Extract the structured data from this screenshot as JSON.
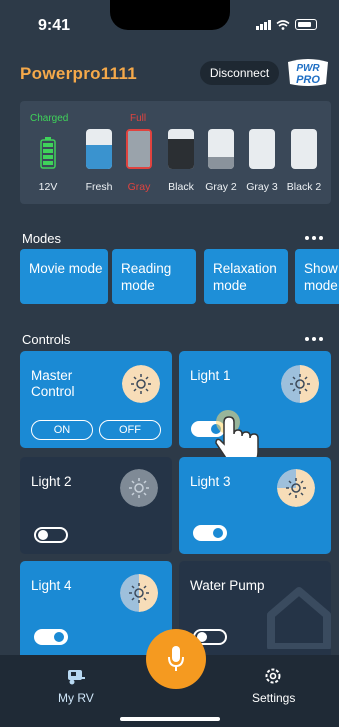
{
  "status_bar": {
    "time": "9:41"
  },
  "header": {
    "brand_name": "Powerpro1111",
    "disconnect_label": "Disconnect",
    "logo_text_top": "PWR",
    "logo_text_bottom": "PRO"
  },
  "tanks": {
    "items": [
      {
        "label": "12V",
        "status": "Charged",
        "status_color": "#3fd35a",
        "kind": "battery",
        "level": 1.0
      },
      {
        "label": "Fresh",
        "level": 0.6,
        "fill_color": "#3a93cf"
      },
      {
        "label": "Gray",
        "status": "Full",
        "status_color": "#e0433f",
        "level": 1.0,
        "fill_color": "#9aa3ab",
        "alert": true
      },
      {
        "label": "Black",
        "level": 0.75,
        "fill_color": "#2b2f33"
      },
      {
        "label": "Gray 2",
        "level": 0.3,
        "fill_color": "#8a939c"
      },
      {
        "label": "Gray 3",
        "level": 0.0,
        "fill_color": "#8a939c"
      },
      {
        "label": "Black 2",
        "level": 0.0,
        "fill_color": "#2b2f33"
      }
    ]
  },
  "modes": {
    "title": "Modes",
    "items": [
      {
        "label": "Movie mode"
      },
      {
        "label": "Reading mode"
      },
      {
        "label": "Relaxation mode"
      },
      {
        "label": "Show mode"
      }
    ]
  },
  "controls": {
    "title": "Controls",
    "master": {
      "title": "Master Control",
      "on_label": "ON",
      "off_label": "OFF"
    },
    "light1": {
      "title": "Light 1",
      "level": 0.5,
      "on": true
    },
    "light2": {
      "title": "Light 2",
      "level": 0.0,
      "on": false
    },
    "light3": {
      "title": "Light 3",
      "level": 0.75,
      "on": true
    },
    "light4": {
      "title": "Light 4",
      "level": 0.5,
      "on": true
    },
    "pump": {
      "title": "Water Pump",
      "on": false
    }
  },
  "bottom_nav": {
    "my_rv_label": "My RV",
    "settings_label": "Settings"
  },
  "colors": {
    "accent": "#f5a94a",
    "card_on": "#1b8ad4",
    "card_off": "#253447",
    "mode_bg": "#1e8fd8",
    "mic": "#f59a20"
  }
}
